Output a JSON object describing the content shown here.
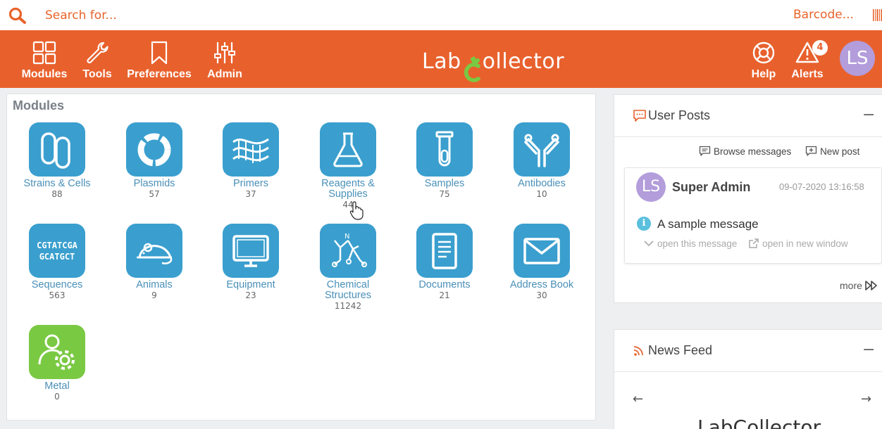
{
  "search": {
    "placeholder": "Search for...",
    "barcode_label": "Barcode..."
  },
  "nav": {
    "items": [
      {
        "label": "Modules",
        "icon": "grid-icon"
      },
      {
        "label": "Tools",
        "icon": "wrench-icon"
      },
      {
        "label": "Preferences",
        "icon": "bookmark-icon"
      },
      {
        "label": "Admin",
        "icon": "sliders-icon"
      }
    ],
    "logo_prefix": "Lab",
    "logo_suffix": "ollector",
    "help_label": "Help",
    "alerts_label": "Alerts",
    "alerts_count": "4",
    "user_initials": "LS"
  },
  "modules": {
    "title": "Modules",
    "items": [
      {
        "name": "Strains & Cells",
        "count": "88",
        "icon": "strains-icon"
      },
      {
        "name": "Plasmids",
        "count": "57",
        "icon": "plasmid-icon"
      },
      {
        "name": "Primers",
        "count": "37",
        "icon": "primer-icon"
      },
      {
        "name": "Reagents & Supplies",
        "count": "44",
        "icon": "flask-icon"
      },
      {
        "name": "Samples",
        "count": "75",
        "icon": "test-tube-icon"
      },
      {
        "name": "Antibodies",
        "count": "10",
        "icon": "antibody-icon"
      },
      {
        "name": "Sequences",
        "count": "563",
        "icon": "sequence-icon",
        "seq_line1": "CGTATCGA",
        "seq_line2": "GCATGCT"
      },
      {
        "name": "Animals",
        "count": "9",
        "icon": "mouse-icon"
      },
      {
        "name": "Equipment",
        "count": "23",
        "icon": "monitor-icon"
      },
      {
        "name": "Chemical Structures",
        "count": "11242",
        "icon": "molecule-icon",
        "atom_label": "N"
      },
      {
        "name": "Documents",
        "count": "21",
        "icon": "document-icon"
      },
      {
        "name": "Address Book",
        "count": "30",
        "icon": "envelope-icon"
      },
      {
        "name": "Metal",
        "count": "0",
        "icon": "user-gear-icon"
      }
    ]
  },
  "posts": {
    "title": "User Posts",
    "minimize": "−",
    "browse_label": "Browse messages",
    "new_label": "New post",
    "post": {
      "initials": "LS",
      "author": "Super Admin",
      "date": "09-07-2020 13:16:58",
      "message": "A sample message",
      "open_label": "open this message",
      "open_new_label": "open in new window"
    },
    "more_label": "more"
  },
  "news": {
    "title": "News Feed",
    "minimize": "−",
    "logo_text": "LabCollector"
  },
  "colors": {
    "brand_orange": "#e8612d",
    "module_blue": "#3a9fce",
    "module_green": "#7ac943",
    "avatar_purple": "#b39ddb"
  }
}
